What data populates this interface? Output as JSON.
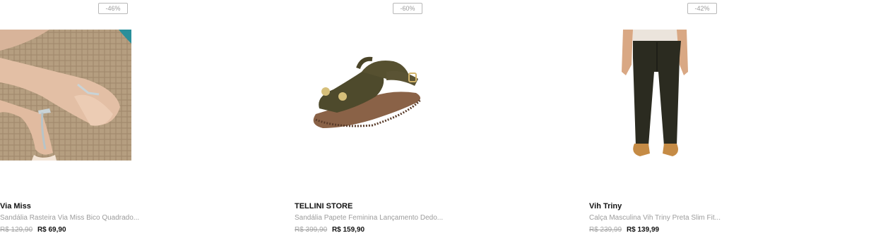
{
  "products": [
    {
      "discount": "-46%",
      "brand": "Via Miss",
      "title": "Sandália Rasteira Via Miss Bico Quadrado...",
      "old_price": "R$ 129,90",
      "price": "R$ 69,90"
    },
    {
      "discount": "-60%",
      "brand": "TELLINI STORE",
      "title": "Sandália Papete Feminina Lançamento Dedo...",
      "old_price": "R$ 399,90",
      "price": "R$ 159,90"
    },
    {
      "discount": "-42%",
      "brand": "Vih Triny",
      "title": "Calça Masculina Vih Triny Preta Slim Fit...",
      "old_price": "R$ 239,99",
      "price": "R$ 139,99"
    }
  ]
}
